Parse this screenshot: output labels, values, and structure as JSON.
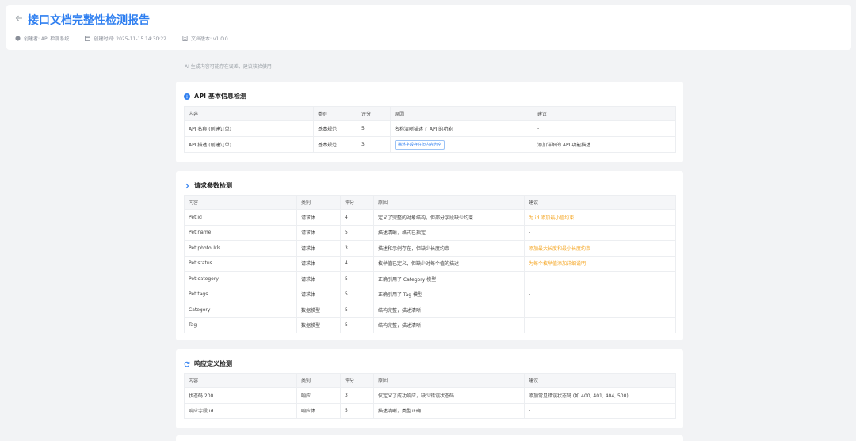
{
  "header": {
    "title": "接口文档完整性检测报告",
    "meta": {
      "creator": "创建者: API 检测系统",
      "created_time": "创建时间: 2025-11-15 14:30:22",
      "doc_version": "文档版本: v1.0.0"
    }
  },
  "notice": "AI 生成内容可能存在误差，建议核验使用",
  "sections": {
    "api_basic": {
      "title": "API 基本信息检测",
      "icon": "info-icon",
      "headers": [
        "内容",
        "类别",
        "评分",
        "原因",
        "建议"
      ],
      "rows": [
        {
          "content": "API 名称 (创建订单)",
          "category": "基本规范",
          "score": "5",
          "reason": "名称清晰描述了 API 的功能",
          "suggestion": "-"
        },
        {
          "content": "API 描述 (创建订单)",
          "category": "基本规范",
          "score": "3",
          "reason": "描述字段存在但内容为空",
          "suggestion": "添加详细的 API 功能描述"
        }
      ]
    },
    "request_params": {
      "title": "请求参数检测",
      "icon": "chevron-right-icon",
      "headers": [
        "内容",
        "类别",
        "评分",
        "原因",
        "建议"
      ],
      "rows": [
        {
          "content": "Pet.id",
          "category": "请求体",
          "score": "4",
          "reason": "定义了完整的对象结构，但部分字段缺少约束",
          "suggestion": "为 id 添加最小值约束"
        },
        {
          "content": "Pet.name",
          "category": "请求体",
          "score": "5",
          "reason": "描述清晰，格式已指定",
          "suggestion": "-"
        },
        {
          "content": "Pet.photoUrls",
          "category": "请求体",
          "score": "3",
          "reason": "描述和示例存在，但缺少长度约束",
          "suggestion": "添加最大长度和最小长度约束"
        },
        {
          "content": "Pet.status",
          "category": "请求体",
          "score": "4",
          "reason": "枚举值已定义，但缺少对每个值的描述",
          "suggestion": "为每个枚举值添加详细说明"
        },
        {
          "content": "Pet.category",
          "category": "请求体",
          "score": "5",
          "reason": "正确引用了 Category 模型",
          "suggestion": "-"
        },
        {
          "content": "Pet.tags",
          "category": "请求体",
          "score": "5",
          "reason": "正确引用了 Tag 模型",
          "suggestion": "-"
        },
        {
          "content": "Category",
          "category": "数据模型",
          "score": "5",
          "reason": "结构完整，描述清晰",
          "suggestion": "-"
        },
        {
          "content": "Tag",
          "category": "数据模型",
          "score": "5",
          "reason": "结构完整，描述清晰",
          "suggestion": "-"
        }
      ]
    },
    "response_def": {
      "title": "响应定义检测",
      "icon": "refresh-icon",
      "headers": [
        "内容",
        "类别",
        "评分",
        "原因",
        "建议"
      ],
      "rows": [
        {
          "content": "状态码 200",
          "category": "响应",
          "score": "3",
          "reason": "仅定义了成功响应，缺少错误状态码",
          "suggestion": "添加常见错误状态码 (如 400, 401, 404, 500)"
        },
        {
          "content": "响应字段 id",
          "category": "响应体",
          "score": "5",
          "reason": "描述清晰，类型正确",
          "suggestion": "-"
        }
      ]
    }
  },
  "colors": {
    "accent": "#2f7ff0",
    "warning": "#f5a623",
    "background": "#f2f3f5"
  }
}
